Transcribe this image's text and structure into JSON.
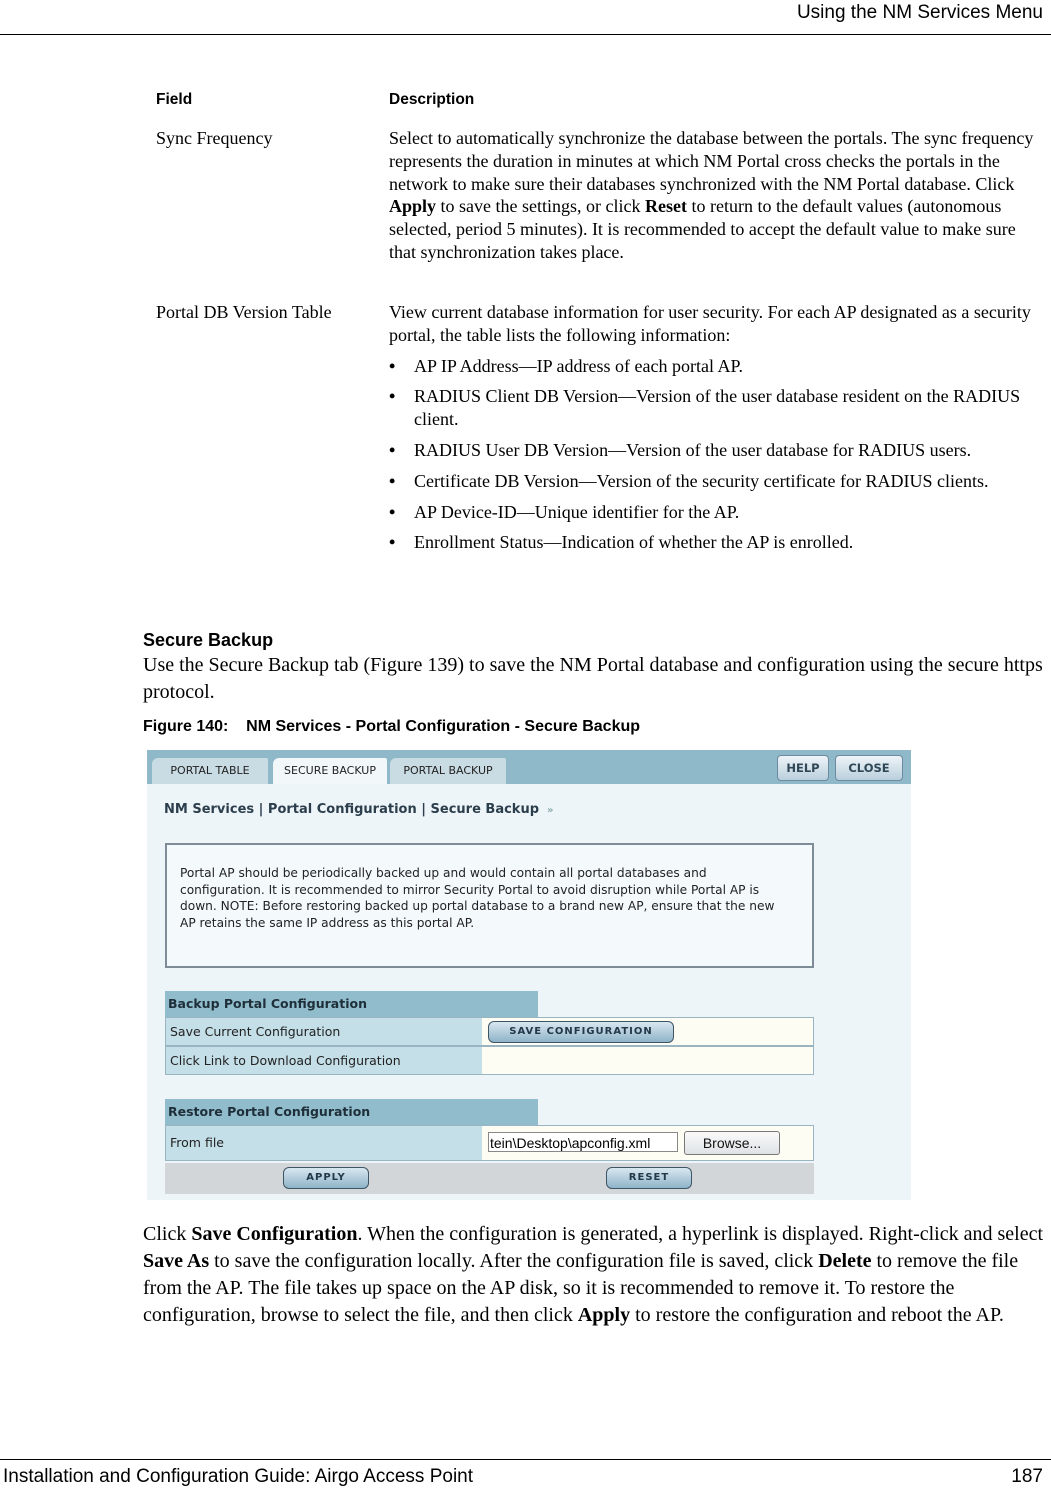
{
  "header": {
    "title": "Using the NM Services Menu"
  },
  "table": {
    "col_field": "Field",
    "col_description": "Description",
    "rows": [
      {
        "field": "Sync Frequency",
        "description_parts": {
          "a": "Select to automatically synchronize the database between the portals. The sync frequency represents the duration in minutes at which NM Portal cross checks the portals in the network to make sure their databases synchronized with the NM Portal database. Click ",
          "b": "Apply",
          "c": " to save the settings, or click ",
          "d": "Reset",
          "e": " to return to the default values (autonomous selected, period 5 minutes). It is recommended to accept the default value to make sure that synchronization takes place."
        }
      },
      {
        "field": "Portal DB Version Table",
        "intro": "View current database information for user security. For each AP designated as a security portal, the table lists the following information:",
        "bullets": [
          "AP IP Address—IP address of each portal AP.",
          "RADIUS Client DB Version—Version of the user database resident on the RADIUS client.",
          "RADIUS User DB Version—Version of the user database for RADIUS users.",
          "Certificate DB Version—Version of the security certificate for RADIUS clients.",
          "AP Device-ID—Unique identifier for the AP.",
          "Enrollment Status—Indication of whether the AP is enrolled."
        ]
      }
    ]
  },
  "section": {
    "heading": "Secure Backup",
    "intro": "Use the Secure Backup tab (Figure 139) to save the NM Portal database and configuration using the secure https protocol."
  },
  "figure": {
    "caption": "Figure 140:    NM Services - Portal Configuration - Secure Backup",
    "tabs": [
      "PORTAL TABLE",
      "SECURE BACKUP",
      "PORTAL BACKUP"
    ],
    "active_tab": "SECURE BACKUP",
    "help_label": "HELP",
    "close_label": "CLOSE",
    "breadcrumb": "NM Services | Portal Configuration | Secure Backup",
    "breadcrumb_icon": "»",
    "note": "Portal AP should be periodically backed up and would contain all portal databases and configuration. It is recommended to mirror Security Portal to avoid disruption while Portal AP is down. NOTE: Before restoring backed up portal database to a brand new AP, ensure that the new AP retains the same IP address as this portal AP.",
    "backup_header": "Backup Portal Configuration",
    "save_current_label": "Save Current Configuration",
    "save_button": "SAVE CONFIGURATION",
    "download_label": "Click Link to Download Configuration",
    "restore_header": "Restore Portal Configuration",
    "from_file_label": "From file",
    "file_value": "tein\\Desktop\\apconfig.xml",
    "browse_label": "Browse...",
    "apply_button": "APPLY",
    "reset_button": "RESET"
  },
  "closing": {
    "t1": "Click ",
    "b1": "Save Configuration",
    "t2": ". When the configuration is generated, a hyperlink is displayed. Right-click and select ",
    "b2": "Save As",
    "t3": " to save the configuration locally. After the configuration file is saved, click ",
    "b3": "Delete",
    "t4": " to remove the file from the AP. The file takes up space on the AP disk, so it is recommended to remove it. To restore the configuration, browse to select the file, and then click ",
    "b4": "Apply",
    "t5": " to restore the configuration and reboot the AP."
  },
  "footer": {
    "guide_title": "Installation and Configuration Guide: Airgo Access Point",
    "page_number": "187"
  }
}
